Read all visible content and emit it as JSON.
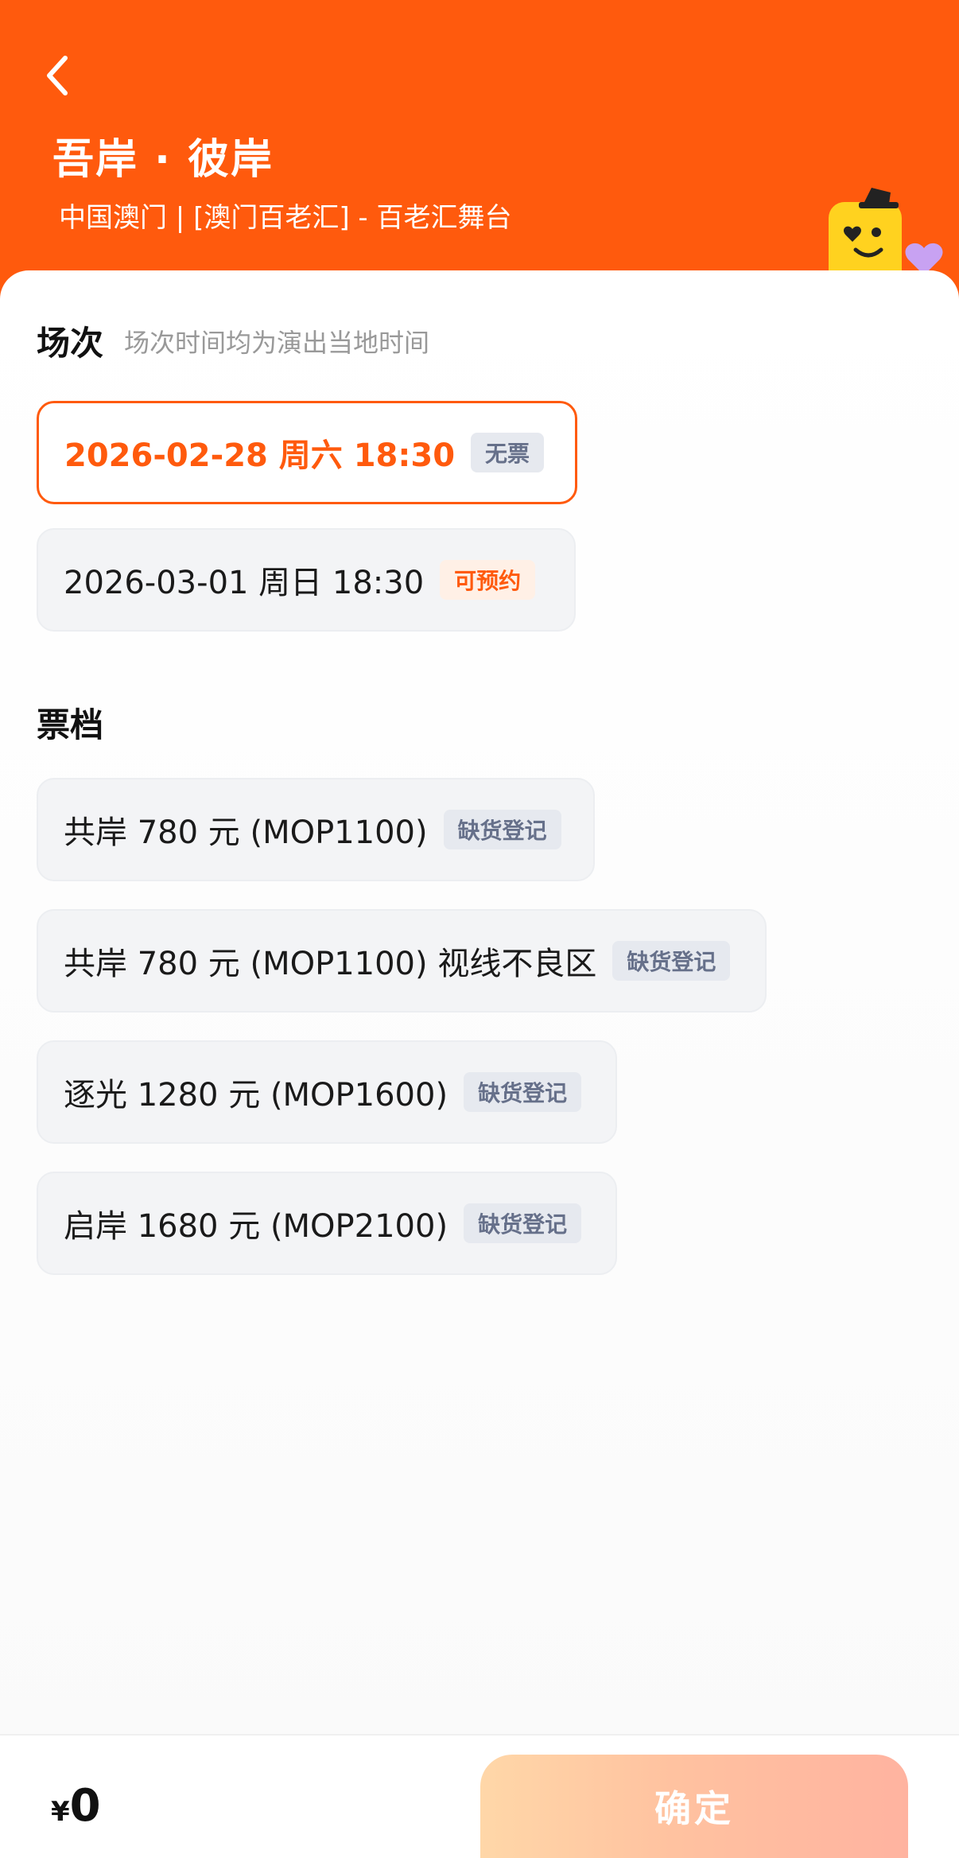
{
  "header": {
    "title": "吾岸 · 彼岸",
    "subtitle": "中国澳门 | [澳门百老汇] - 百老汇舞台"
  },
  "sessions": {
    "title": "场次",
    "hint": "场次时间均为演出当地时间",
    "items": [
      {
        "label": "2026-02-28  周六 18:30",
        "tag": "无票",
        "selected": true
      },
      {
        "label": "2026-03-01 周日 18:30",
        "tag": "可预约",
        "selected": false
      }
    ]
  },
  "tiers": {
    "title": "票档",
    "items": [
      {
        "label": "共岸 780 元 (MOP1100)",
        "tag": "缺货登记"
      },
      {
        "label": "共岸 780 元 (MOP1100) 视线不良区",
        "tag": "缺货登记"
      },
      {
        "label": "逐光 1280 元 (MOP1600)",
        "tag": "缺货登记"
      },
      {
        "label": "启岸 1680 元 (MOP2100)",
        "tag": "缺货登记"
      }
    ]
  },
  "footer": {
    "currency": "¥",
    "amount": "0",
    "confirm_label": "确定"
  },
  "colors": {
    "brand": "#ff5a0d",
    "tag_gray_bg": "#e6e9ef",
    "tag_orange_bg": "#fff0e6"
  },
  "icons": {
    "back": "chevron-left-icon",
    "mascot": "mascot-icon"
  }
}
